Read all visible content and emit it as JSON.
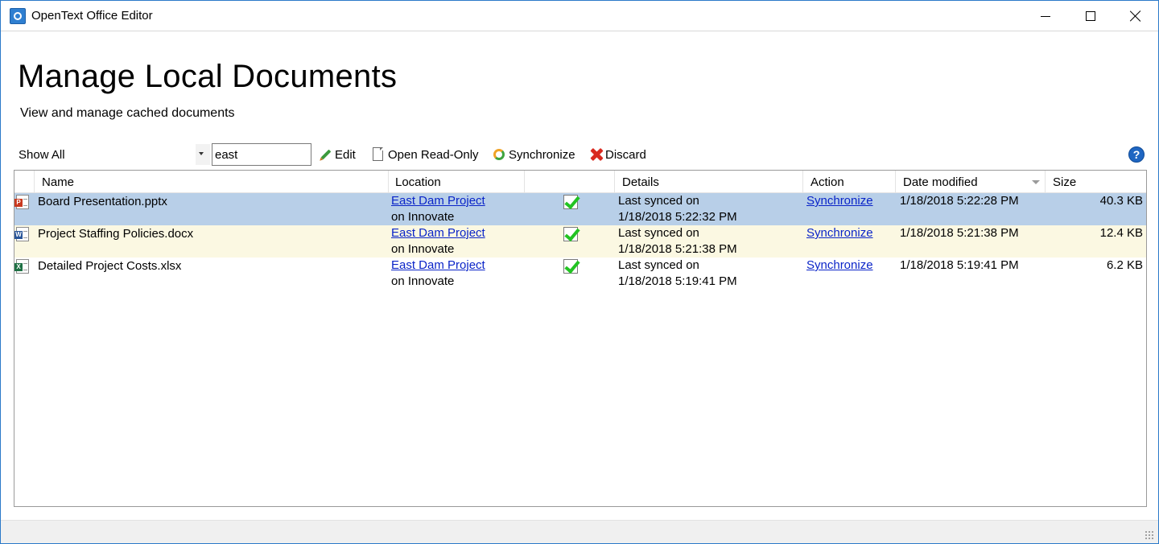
{
  "window": {
    "title": "OpenText Office Editor",
    "accent_color": "#2b79c9"
  },
  "header": {
    "title": "Manage Local Documents",
    "subtitle": "View and manage cached documents"
  },
  "toolbar": {
    "filter_value": "Show All",
    "search_value": "east",
    "edit_label": "Edit",
    "open_read_only_label": "Open Read-Only",
    "synchronize_label": "Synchronize",
    "discard_label": "Discard",
    "help_glyph": "?"
  },
  "grid": {
    "columns": {
      "name": "Name",
      "location": "Location",
      "status": "",
      "details": "Details",
      "action": "Action",
      "date_modified": "Date modified",
      "size": "Size"
    },
    "sorted_by": "Date modified",
    "rows": [
      {
        "file_type": "pptx",
        "file_icon": "powerpoint-file-icon",
        "name": "Board Presentation.pptx",
        "location_link": "East Dam Project",
        "location_suffix": "on Innovate",
        "status_icon": "synced-check-icon",
        "details_line1": "Last synced on",
        "details_line2": "1/18/2018 5:22:32 PM",
        "action": "Synchronize",
        "date_modified": "1/18/2018 5:22:28 PM",
        "size": "40.3 KB",
        "selected": true
      },
      {
        "file_type": "docx",
        "file_icon": "word-file-icon",
        "name": "Project Staffing Policies.docx",
        "location_link": "East Dam Project",
        "location_suffix": "on Innovate",
        "status_icon": "synced-check-icon",
        "details_line1": "Last synced on",
        "details_line2": "1/18/2018 5:21:38 PM",
        "action": "Synchronize",
        "date_modified": "1/18/2018 5:21:38 PM",
        "size": "12.4 KB",
        "selected": false
      },
      {
        "file_type": "xlsx",
        "file_icon": "excel-file-icon",
        "name": "Detailed Project Costs.xlsx",
        "location_link": "East Dam Project",
        "location_suffix": "on Innovate",
        "status_icon": "synced-check-icon",
        "details_line1": "Last synced on",
        "details_line2": "1/18/2018 5:19:41 PM",
        "action": "Synchronize",
        "date_modified": "1/18/2018 5:19:41 PM",
        "size": "6.2 KB",
        "selected": false
      }
    ]
  },
  "colors": {
    "selected_row": "#b8cfe8",
    "alternate_row": "#fbf8e2",
    "link": "#0a24c8",
    "synced_check": "#22c322"
  }
}
